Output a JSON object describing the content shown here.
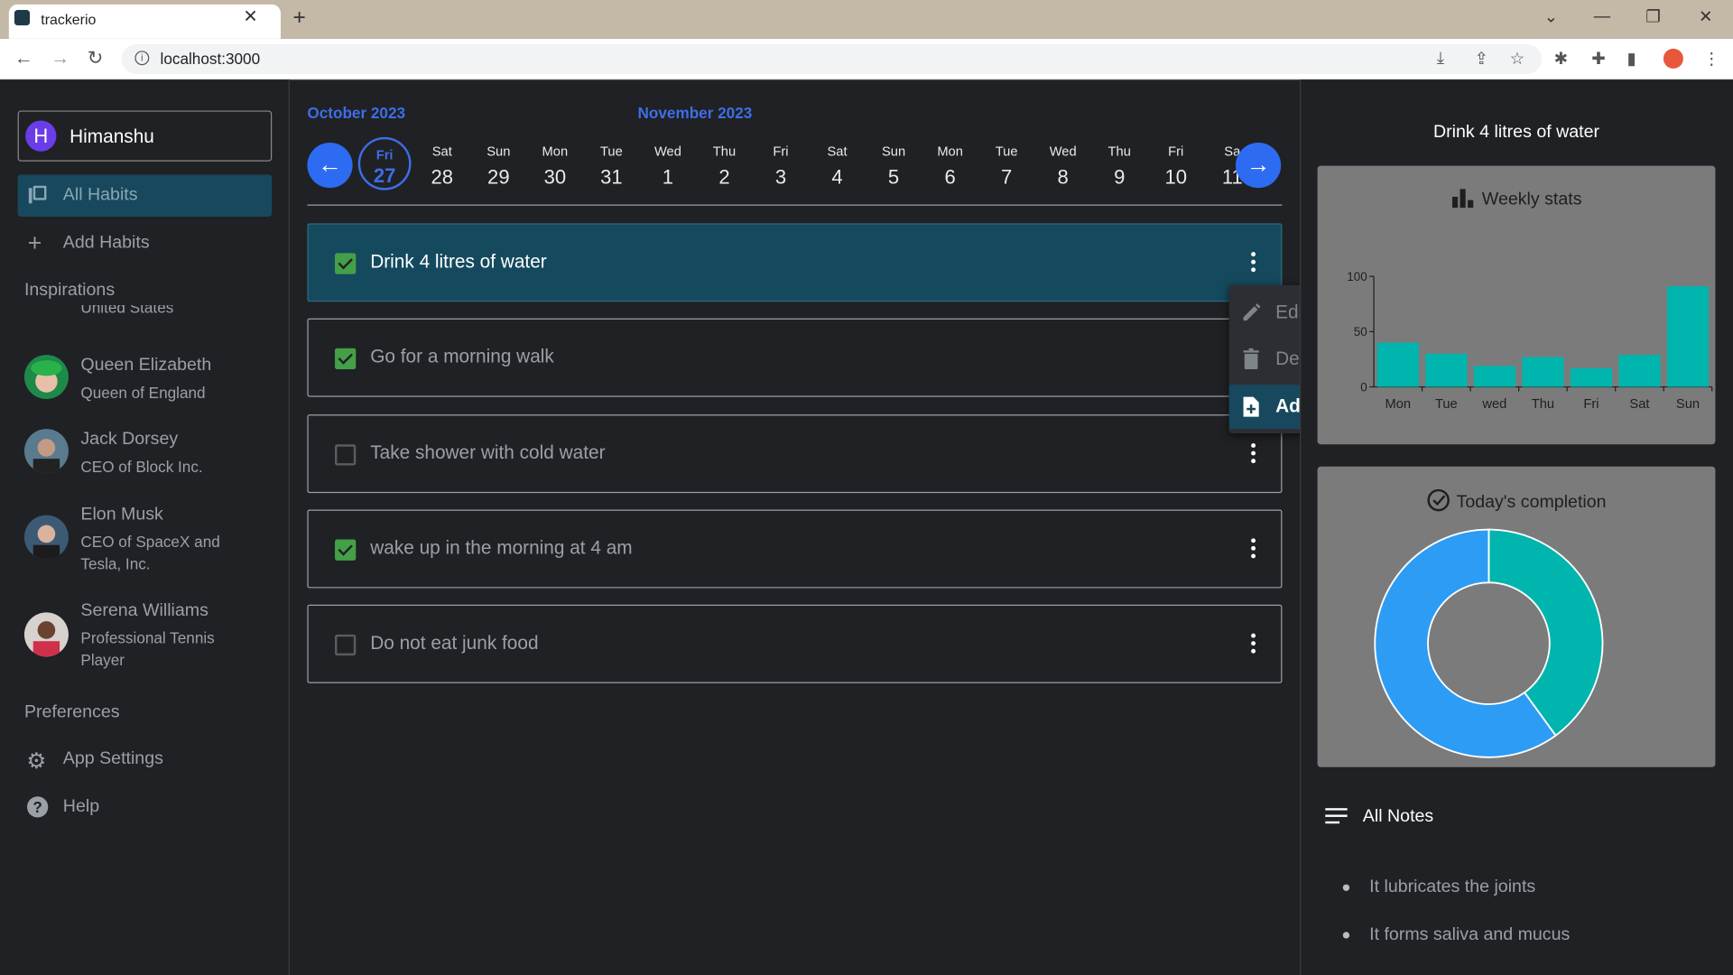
{
  "browser": {
    "tab_title": "trackerio",
    "url": "localhost:3000",
    "tab_close": "✕",
    "new_tab": "+",
    "controls": [
      "⌄",
      "—",
      "❐",
      "✕"
    ]
  },
  "sidebar": {
    "user": {
      "initial": "H",
      "name": "Himanshu"
    },
    "nav": [
      {
        "label": "All Habits",
        "icon": "library-icon"
      },
      {
        "label": "Add Habits",
        "icon": "plus-icon"
      }
    ],
    "inspirations_heading": "Inspirations",
    "clipped_text": "United States",
    "inspirations": [
      {
        "name": "Queen Elizabeth",
        "desc": "Queen of England"
      },
      {
        "name": "Jack Dorsey",
        "desc": "CEO of Block Inc."
      },
      {
        "name": "Elon Musk",
        "desc": "CEO of SpaceX and Tesla, Inc."
      },
      {
        "name": "Serena Williams",
        "desc": "Professional Tennis Player"
      }
    ],
    "preferences_heading": "Preferences",
    "preferences": [
      {
        "label": "App Settings",
        "icon": "gear-icon"
      },
      {
        "label": "Help",
        "icon": "help-icon"
      }
    ]
  },
  "calendar": {
    "months": [
      "October 2023",
      "November 2023"
    ],
    "selected": {
      "dow": "Fri",
      "date": "27"
    },
    "days": [
      {
        "dow": "Sat",
        "date": "28"
      },
      {
        "dow": "Sun",
        "date": "29"
      },
      {
        "dow": "Mon",
        "date": "30"
      },
      {
        "dow": "Tue",
        "date": "31"
      },
      {
        "dow": "Wed",
        "date": "1"
      },
      {
        "dow": "Thu",
        "date": "2"
      },
      {
        "dow": "Fri",
        "date": "3"
      },
      {
        "dow": "Sat",
        "date": "4"
      },
      {
        "dow": "Sun",
        "date": "5"
      },
      {
        "dow": "Mon",
        "date": "6"
      },
      {
        "dow": "Tue",
        "date": "7"
      },
      {
        "dow": "Wed",
        "date": "8"
      },
      {
        "dow": "Thu",
        "date": "9"
      },
      {
        "dow": "Fri",
        "date": "10"
      },
      {
        "dow": "Sa",
        "date": "11"
      }
    ],
    "prev": "←",
    "next": "→"
  },
  "habits": [
    {
      "label": "Drink 4 litres of water",
      "checked": true,
      "active": true
    },
    {
      "label": "Go for a morning walk",
      "checked": true,
      "active": false
    },
    {
      "label": "Take shower with cold water",
      "checked": false,
      "active": false
    },
    {
      "label": "wake up in the morning at 4 am",
      "checked": true,
      "active": false
    },
    {
      "label": "Do not eat junk food",
      "checked": false,
      "active": false
    }
  ],
  "menu": [
    {
      "label": "Edit",
      "icon": "pencil-icon"
    },
    {
      "label": "Delete",
      "icon": "trash-icon"
    },
    {
      "label": "Add Note",
      "icon": "note-add-icon",
      "selected": true
    }
  ],
  "panel": {
    "title": "Drink 4 litres of water",
    "weekly_title": "Weekly stats",
    "completion_title": "Today's completion",
    "notes_title": "All Notes",
    "notes": [
      "It lubricates the joints",
      "It forms saliva and mucus"
    ]
  },
  "colors": {
    "accent": "#3d6ee8",
    "bar": "#00b5ad",
    "donut_done": "#00b5ad",
    "donut_left": "#2d9cf5",
    "active_row": "#154a5e"
  },
  "chart_data": [
    {
      "type": "bar",
      "title": "Weekly stats",
      "categories": [
        "Mon",
        "Tue",
        "wed",
        "Thu",
        "Fri",
        "Sat",
        "Sun"
      ],
      "values": [
        40,
        30,
        19,
        27,
        17,
        29,
        91
      ],
      "ylim": [
        0,
        100
      ],
      "yticks": [
        "100",
        "50",
        "0"
      ]
    },
    {
      "type": "pie",
      "title": "Today's completion",
      "values": [
        40,
        60
      ],
      "colors": [
        "#00b5ad",
        "#2d9cf5"
      ]
    }
  ]
}
